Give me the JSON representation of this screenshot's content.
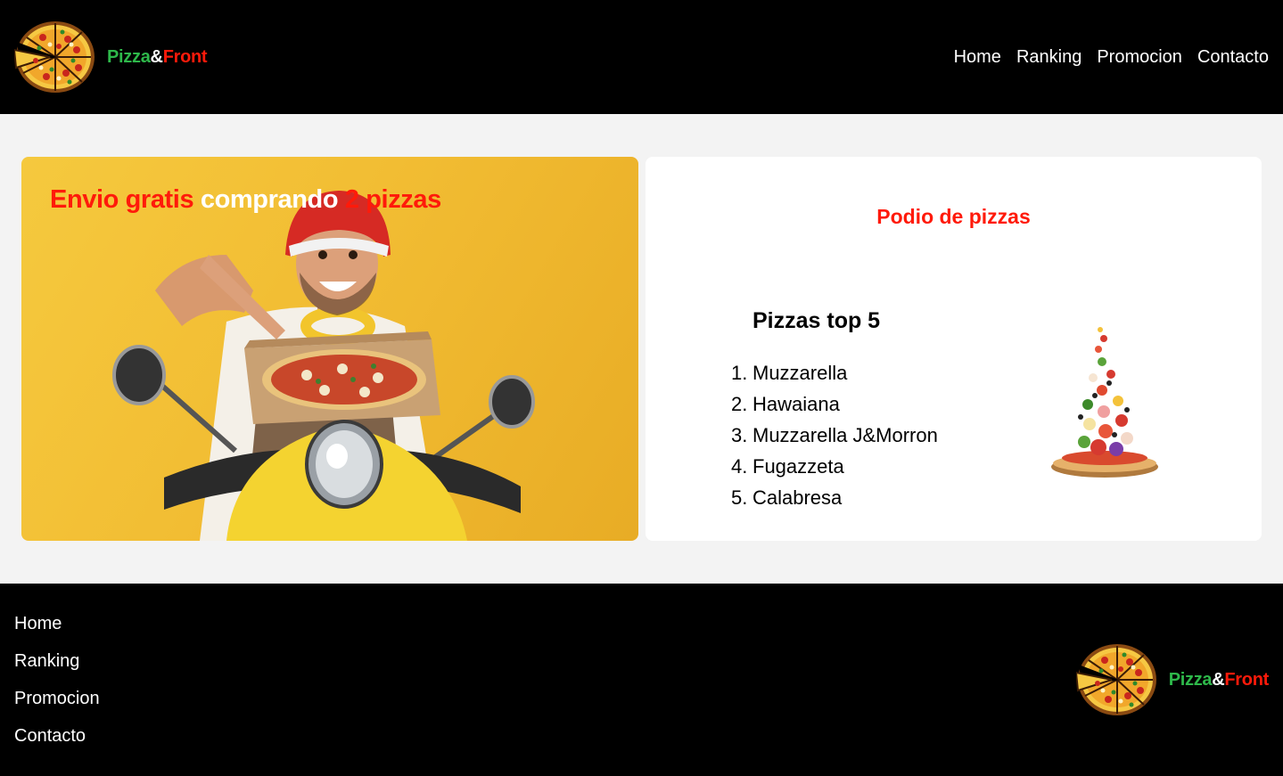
{
  "header": {
    "brand": {
      "part1": "Pizza",
      "amp": "&",
      "part2": "Front",
      "logo_icon": "pizza-logo-icon"
    },
    "nav": [
      "Home",
      "Ranking",
      "Promocion",
      "Contacto"
    ]
  },
  "promo": {
    "title_part1": "Envio gratis",
    "title_part2": "comprando",
    "title_part3": "2 pizzas",
    "image": "delivery-man-scooter-image"
  },
  "podium": {
    "title": "Podio de pizzas",
    "heading": "Pizzas top 5",
    "items": [
      {
        "num": "1.",
        "name": "Muzzarella"
      },
      {
        "num": "2.",
        "name": "Hawaiana"
      },
      {
        "num": "3.",
        "name": "Muzzarella J&Morron"
      },
      {
        "num": "4.",
        "name": "Fugazzeta"
      },
      {
        "num": "5.",
        "name": "Calabresa"
      }
    ],
    "image": "pizza-ingredients-image"
  },
  "footer": {
    "nav": [
      "Home",
      "Ranking",
      "Promocion",
      "Contacto"
    ],
    "brand": {
      "part1": "Pizza",
      "amp": "&",
      "part2": "Front"
    }
  },
  "colors": {
    "header_bg": "#000000",
    "accent_red": "#ff1a0a",
    "accent_green": "#2eb84a",
    "page_bg": "#f3f3f3",
    "promo_bg": "#f2bd33"
  }
}
